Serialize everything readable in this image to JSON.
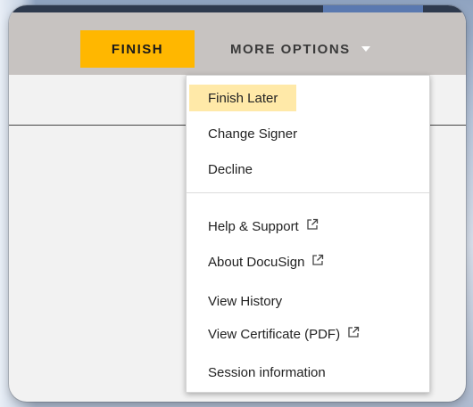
{
  "toolbar": {
    "finish_label": "FINISH",
    "more_options_label": "MORE OPTIONS"
  },
  "menu": {
    "items": [
      {
        "label": "Finish Later",
        "highlighted": true,
        "external": false
      },
      {
        "label": "Change Signer",
        "highlighted": false,
        "external": false
      },
      {
        "label": "Decline",
        "highlighted": false,
        "external": false
      },
      {
        "label": "Help & Support",
        "highlighted": false,
        "external": true
      },
      {
        "label": "About DocuSign",
        "highlighted": false,
        "external": true
      },
      {
        "label": "View History",
        "highlighted": false,
        "external": false
      },
      {
        "label": "View Certificate (PDF)",
        "highlighted": false,
        "external": true
      },
      {
        "label": "Session information",
        "highlighted": false,
        "external": false
      }
    ]
  },
  "colors": {
    "finish_button": "#ffb700",
    "toolbar": "#c7c3c1",
    "highlight": "#ffe9a8"
  }
}
